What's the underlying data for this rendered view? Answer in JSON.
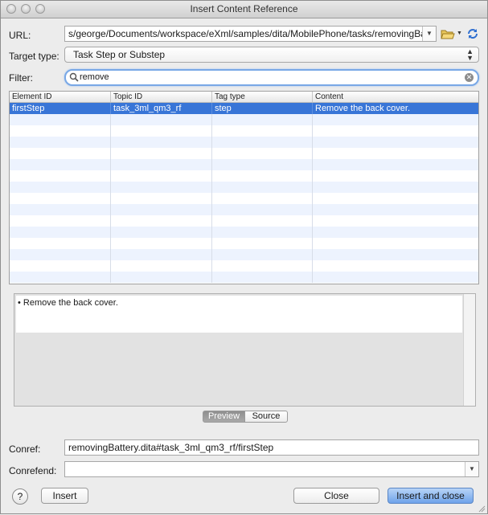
{
  "window": {
    "title": "Insert Content Reference"
  },
  "url": {
    "label": "URL:",
    "value": "s/george/Documents/workspace/eXml/samples/dita/MobilePhone/tasks/removingBattery.dita"
  },
  "target_type": {
    "label": "Target type:",
    "value": "Task Step or Substep"
  },
  "filter": {
    "label": "Filter:",
    "value": "remove"
  },
  "table": {
    "columns": [
      "Element ID",
      "Topic ID",
      "Tag type",
      "Content"
    ],
    "rows": [
      {
        "element_id": "firstStep",
        "topic_id": "task_3ml_qm3_rf",
        "tag_type": "step",
        "content": "Remove the back cover.",
        "selected": true
      }
    ]
  },
  "preview": {
    "text": "• Remove the back cover."
  },
  "tabs": {
    "preview_label": "Preview",
    "source_label": "Source",
    "active": "Preview"
  },
  "conref": {
    "label": "Conref:",
    "value": "removingBattery.dita#task_3ml_qm3_rf/firstStep"
  },
  "conrefend": {
    "label": "Conrefend:",
    "value": ""
  },
  "buttons": {
    "help": "?",
    "insert": "Insert",
    "close": "Close",
    "insert_close": "Insert and close"
  },
  "colors": {
    "selection": "#3875d7",
    "alt_row": "#edf3fe",
    "focus_ring": "#79a8e6",
    "primary_button": "#6fa3ea"
  },
  "icons": {
    "browse": "folder-open-icon",
    "reload": "reload-icon",
    "search": "magnifier-icon",
    "clear": "clear-search-icon"
  }
}
